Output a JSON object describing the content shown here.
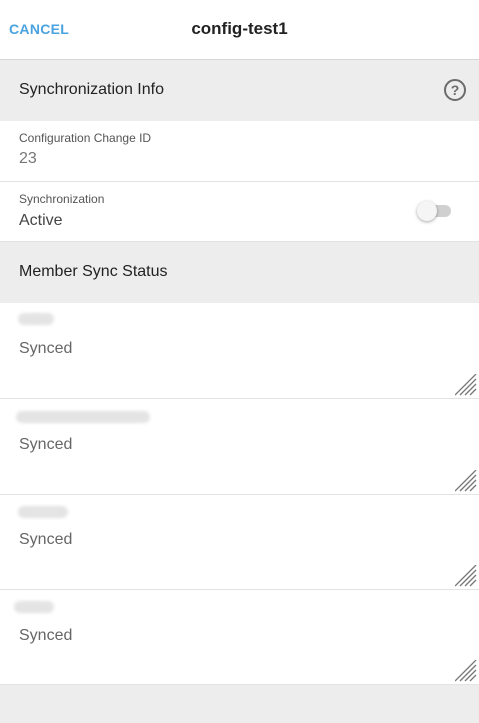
{
  "header": {
    "cancel_label": "CANCEL",
    "title": "config-test1"
  },
  "sync_info": {
    "section_title": "Synchronization Info",
    "help_icon": "help-circle-icon",
    "change_id_label": "Configuration Change ID",
    "change_id_value": "23",
    "sync_label": "Synchronization",
    "sync_value": "Active",
    "sync_toggle_on": false
  },
  "member_sync": {
    "section_title": "Member Sync Status",
    "members": [
      {
        "status": "Synced"
      },
      {
        "status": "Synced"
      },
      {
        "status": "Synced"
      },
      {
        "status": "Synced"
      }
    ]
  },
  "colors": {
    "accent": "#4aa3df",
    "section_bg": "#ededed",
    "card_bg": "#ffffff"
  }
}
